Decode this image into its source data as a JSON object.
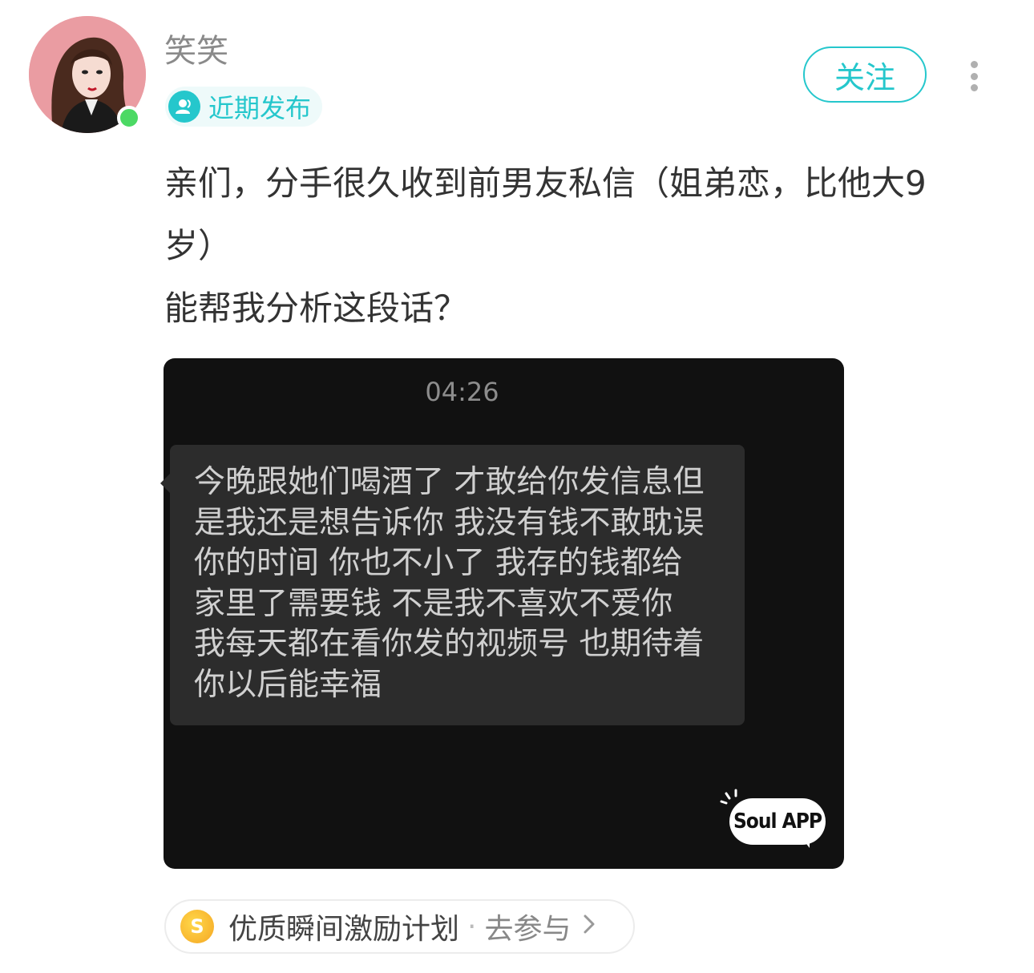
{
  "post": {
    "username": "笑笑",
    "tag_label": "近期发布",
    "follow_label": "关注",
    "text_lines": [
      "亲们，分手很久收到前男友私信（姐弟恋，比他大9",
      "岁）",
      "能帮我分析这段话？"
    ]
  },
  "screenshot": {
    "time": "04:26",
    "message_lines": [
      "今晚跟她们喝酒了 才敢给你发信息但",
      "是我还是想告诉你 我没有钱不敢耽误",
      "你的时间 你也不小了 我存的钱都给",
      "家里了需要钱 不是我不喜欢不爱你",
      "我每天都在看你发的视频号 也期待着",
      "你以后能幸福"
    ],
    "watermark": "Soul APP"
  },
  "incentive": {
    "title": "优质瞬间激励计划",
    "separator": "·",
    "action": "去参与",
    "coin_symbol": "S"
  },
  "colors": {
    "accent": "#25c7cc",
    "online": "#4cd964",
    "card_bg": "#111111",
    "bubble_bg": "#2c2c2c"
  },
  "icons": [
    "avatar",
    "user-tag-icon",
    "more-vertical-icon",
    "coin-icon",
    "chevron-right-icon"
  ]
}
